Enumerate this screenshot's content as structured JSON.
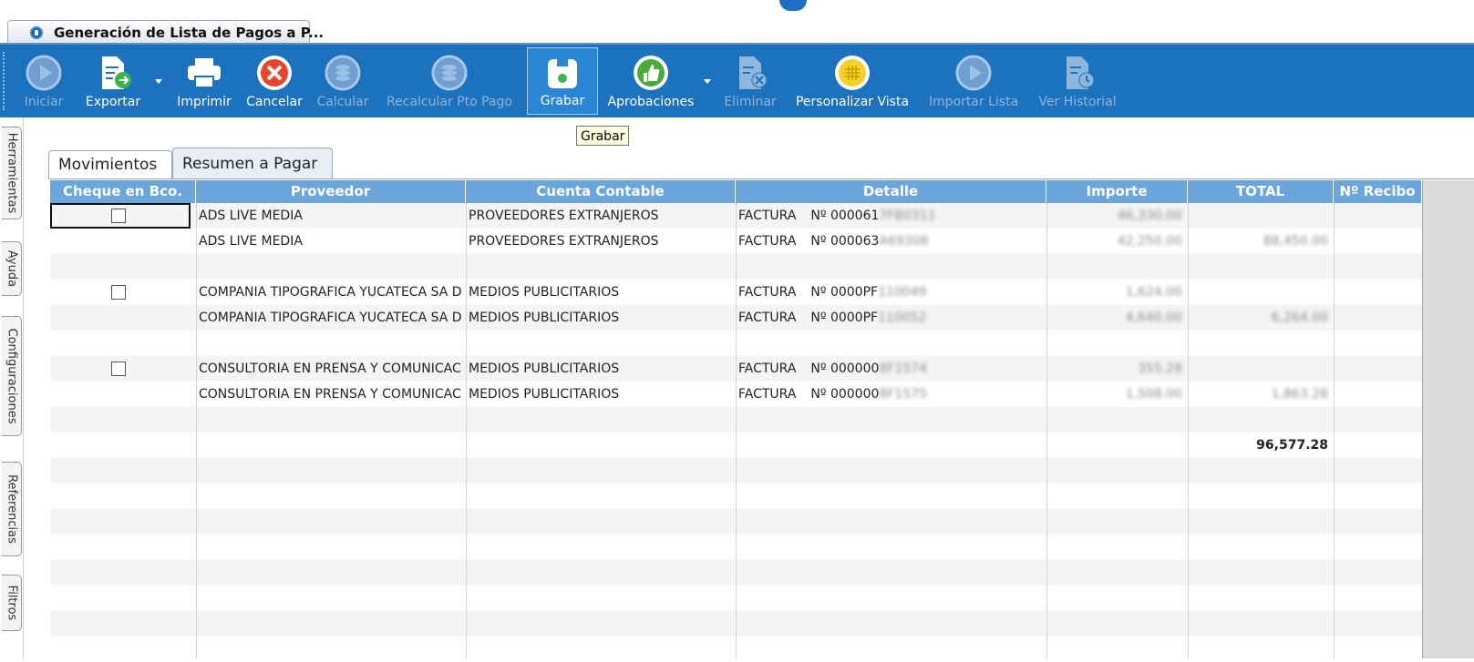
{
  "window": {
    "tab_title": "Generación de Lista de Pagos a P..."
  },
  "toolbar": {
    "buttons": [
      {
        "label": "Iniciar",
        "icon": "play-circle-icon",
        "enabled": false
      },
      {
        "label": "Exportar",
        "icon": "export-document-icon",
        "enabled": true,
        "dropdown": true
      },
      {
        "label": "Imprimir",
        "icon": "printer-icon",
        "enabled": true
      },
      {
        "label": "Cancelar",
        "icon": "cancel-x-icon",
        "enabled": true
      },
      {
        "label": "Calcular",
        "icon": "coins-icon",
        "enabled": false
      },
      {
        "label": "Recalcular Pto Pago",
        "icon": "coins-icon",
        "enabled": false
      },
      {
        "label": "Grabar",
        "icon": "save-disk-icon",
        "enabled": true,
        "active": true
      },
      {
        "label": "Aprobaciones",
        "icon": "thumbs-up-icon",
        "enabled": true,
        "dropdown": true
      },
      {
        "label": "Eliminar",
        "icon": "delete-document-icon",
        "enabled": false
      },
      {
        "label": "Personalizar Vista",
        "icon": "grid-view-icon",
        "enabled": true
      },
      {
        "label": "Importar Lista",
        "icon": "play-circle-icon",
        "enabled": false
      },
      {
        "label": "Ver Historial",
        "icon": "history-document-icon",
        "enabled": false
      }
    ],
    "tooltip": "Grabar"
  },
  "sidebar": {
    "tabs": [
      "Herramientas",
      "Ayuda",
      "Configuraciones",
      "Referencias",
      "Filtros"
    ]
  },
  "content": {
    "tabs": [
      {
        "label": "Movimientos",
        "active": false
      },
      {
        "label": "Resumen a Pagar",
        "active": true
      }
    ]
  },
  "grid": {
    "columns": [
      "Cheque en Bco.",
      "Proveedor",
      "Cuenta Contable",
      "Detalle",
      "Importe",
      "TOTAL",
      "Nº Recibo"
    ],
    "rows": [
      {
        "checkbox": true,
        "proveedor": "ADS LIVE MEDIA",
        "cuenta": "PROVEEDORES EXTRANJEROS",
        "detalle_tipo": "FACTURA",
        "detalle_num": "Nº 000061",
        "detalle_hidden": "7FB0311",
        "importe": "46,330.00",
        "total": "",
        "recibo": ""
      },
      {
        "checkbox": false,
        "proveedor": "ADS LIVE MEDIA",
        "cuenta": "PROVEEDORES EXTRANJEROS",
        "detalle_tipo": "FACTURA",
        "detalle_num": "Nº 000063",
        "detalle_hidden": "A69308",
        "importe": "42,250.00",
        "total": "88,450.00",
        "recibo": ""
      },
      {
        "blank": true
      },
      {
        "checkbox": true,
        "proveedor": "COMPANIA TIPOGRAFICA YUCATECA SA D",
        "cuenta": "MEDIOS PUBLICITARIOS",
        "detalle_tipo": "FACTURA",
        "detalle_num": "Nº 0000PF",
        "detalle_hidden": "110049",
        "importe": "1,624.00",
        "total": "",
        "recibo": ""
      },
      {
        "checkbox": false,
        "proveedor": "COMPANIA TIPOGRAFICA YUCATECA SA D",
        "cuenta": "MEDIOS PUBLICITARIOS",
        "detalle_tipo": "FACTURA",
        "detalle_num": "Nº 0000PF",
        "detalle_hidden": "110052",
        "importe": "4,640.00",
        "total": "6,264.00",
        "recibo": ""
      },
      {
        "blank": true
      },
      {
        "checkbox": true,
        "proveedor": "CONSULTORIA EN PRENSA Y COMUNICAC",
        "cuenta": "MEDIOS PUBLICITARIOS",
        "detalle_tipo": "FACTURA",
        "detalle_num": "Nº 000000",
        "detalle_hidden": "8F1574",
        "importe": "355.28",
        "total": "",
        "recibo": ""
      },
      {
        "checkbox": false,
        "proveedor": "CONSULTORIA EN PRENSA Y COMUNICAC",
        "cuenta": "MEDIOS PUBLICITARIOS",
        "detalle_tipo": "FACTURA",
        "detalle_num": "Nº 000000",
        "detalle_hidden": "8F1575",
        "importe": "1,508.00",
        "total": "1,863.28",
        "recibo": ""
      },
      {
        "blank": true
      },
      {
        "blank": false,
        "checkbox": false,
        "proveedor": "",
        "cuenta": "",
        "detalle_tipo": "",
        "detalle_num": "",
        "detalle_hidden": "",
        "importe": "",
        "total": "96,577.28",
        "recibo": ""
      }
    ]
  },
  "colors": {
    "toolbar": "#1d72be",
    "header": "#6aa6dc",
    "tooltip_bg": "#ffffe1"
  }
}
